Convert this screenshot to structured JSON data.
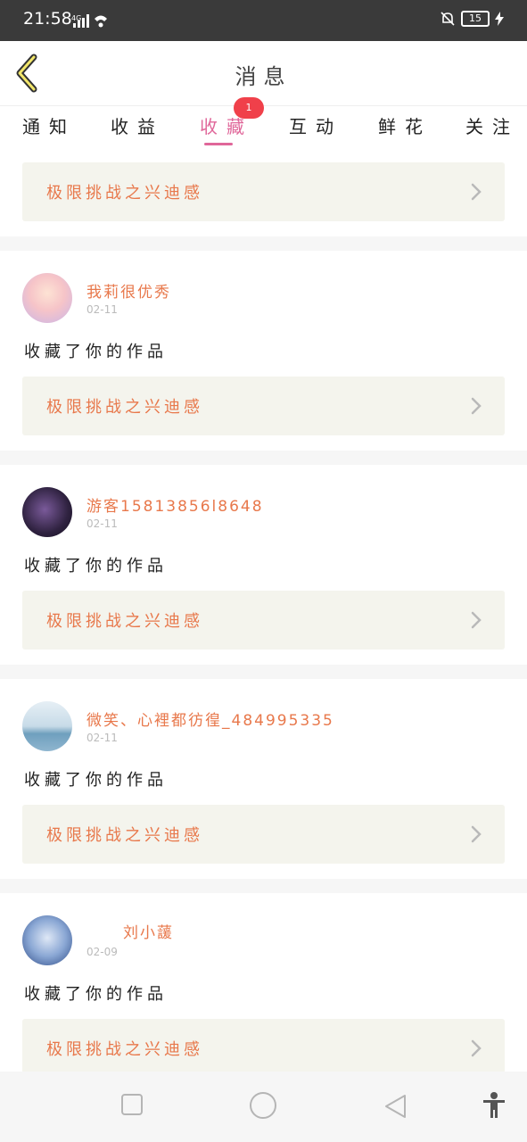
{
  "status": {
    "time": "21:58",
    "network": "4G",
    "battery": "15"
  },
  "header": {
    "title": "消息"
  },
  "tabs": [
    {
      "label": "通知"
    },
    {
      "label": "收益"
    },
    {
      "label": "收藏",
      "badge": "1"
    },
    {
      "label": "互动"
    },
    {
      "label": "鲜花"
    },
    {
      "label": "关注"
    }
  ],
  "work_title": "极限挑战之兴迪感",
  "messages": [
    {
      "name": "我莉很优秀",
      "date": "02-11",
      "action": "收藏了你的作品",
      "work": "极限挑战之兴迪感"
    },
    {
      "name": "游客15813856l8648",
      "date": "02-11",
      "action": "收藏了你的作品",
      "work": "极限挑战之兴迪感"
    },
    {
      "name": "微笑、心裡都彷徨_484995335",
      "date": "02-11",
      "action": "收藏了你的作品",
      "work": "极限挑战之兴迪感"
    },
    {
      "name": "刘小蘐",
      "date": "02-09",
      "action": "收藏了你的作品",
      "work": "极限挑战之兴迪感"
    }
  ],
  "colors": {
    "accent": "#e0679a",
    "orange_text": "#e8784b",
    "badge": "#f0404a",
    "card_bg": "#f4f4ed"
  }
}
